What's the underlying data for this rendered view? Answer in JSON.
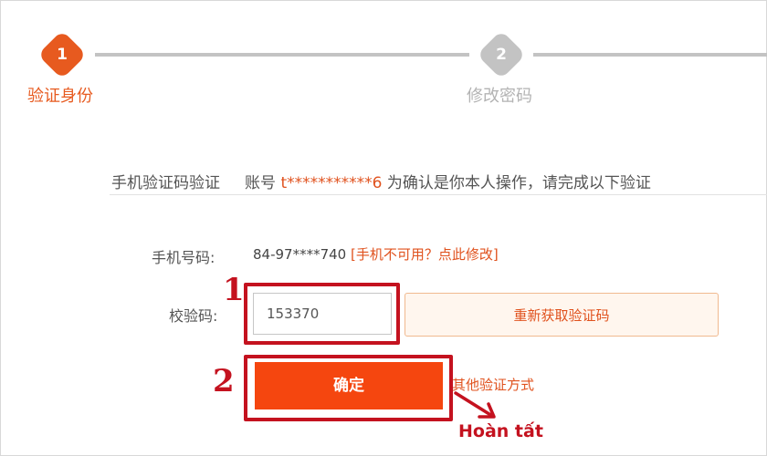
{
  "steps": [
    {
      "number": "1",
      "label": "验证身份",
      "state": "active",
      "color": "#e75a1f"
    },
    {
      "number": "2",
      "label": "修改密码",
      "state": "inactive",
      "color": "#c3c3c3"
    }
  ],
  "verify": {
    "title_prefix": "手机验证码验证",
    "account_label": "账号",
    "account_masked": "t***********6",
    "title_suffix": "为确认是你本人操作，请完成以下验证"
  },
  "phone": {
    "label": "手机号码:",
    "value": "84-97****740",
    "change_link": "[手机不可用？点此修改]"
  },
  "code": {
    "label": "校验码:",
    "value": "153370",
    "resend_button": "重新获取验证码"
  },
  "confirm_button": "确定",
  "other_methods_link": "其他验证方式",
  "annotations": {
    "marker_1": "1",
    "marker_2": "2",
    "done_text": "Hoàn tất",
    "color": "#c4121f"
  },
  "colors": {
    "accent": "#e0521e",
    "button_bg": "#f5460f"
  }
}
